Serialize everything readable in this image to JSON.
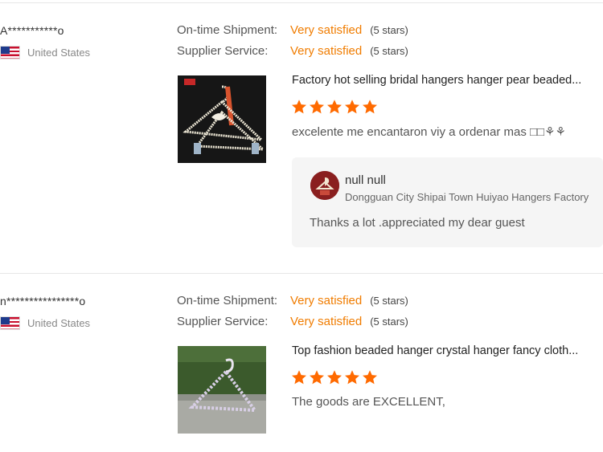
{
  "theme": {
    "accent": "#f07c00",
    "star_color": "#ff6a00"
  },
  "reviews": [
    {
      "buyer": "A***********o",
      "country": "United States",
      "flag_icon": "us-flag-icon",
      "ratings": [
        {
          "label": "On-time Shipment:",
          "value": "Very satisfied",
          "stars": "(5 stars)"
        },
        {
          "label": "Supplier Service:",
          "value": "Very satisfied",
          "stars": "(5 stars)"
        }
      ],
      "product_title": "Factory hot selling bridal hangers hanger pear beaded...",
      "rating": 5,
      "comment": "excelente me encantaron viy a ordenar mas □□⚘⚘",
      "reply": {
        "seller_name": "null null",
        "company": "Dongguan City Shipai Town Huiyao Hangers Factory",
        "text": "Thanks a lot .appreciated my dear guest"
      }
    },
    {
      "buyer": "n****************o",
      "country": "United States",
      "flag_icon": "us-flag-icon",
      "ratings": [
        {
          "label": "On-time Shipment:",
          "value": "Very satisfied",
          "stars": "(5 stars)"
        },
        {
          "label": "Supplier Service:",
          "value": "Very satisfied",
          "stars": "(5 stars)"
        }
      ],
      "product_title": "Top fashion beaded hanger crystal hanger fancy cloth...",
      "rating": 5,
      "comment": "The goods are EXCELLENT,"
    }
  ]
}
